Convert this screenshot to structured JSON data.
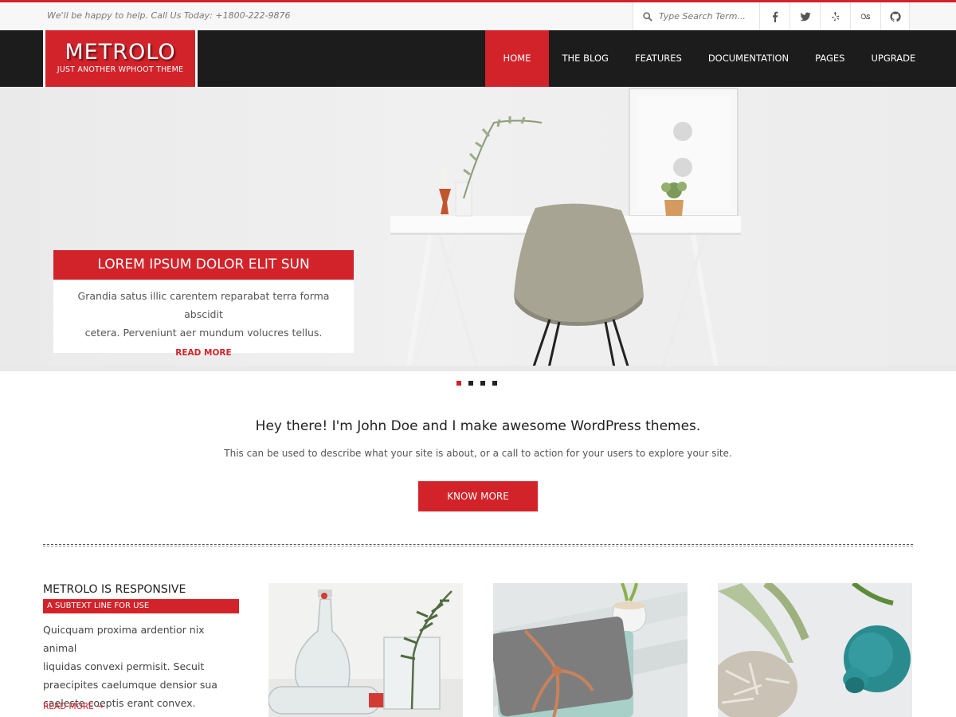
{
  "topbar": {
    "tagline": "We'll be happy to help. Call Us Today: +1800-222-9876",
    "search_placeholder": "Type Search Term...",
    "social": [
      "facebook-icon",
      "twitter-icon",
      "yelp-icon",
      "lastfm-icon",
      "github-icon"
    ]
  },
  "logo": {
    "name": "METROLO",
    "tagline": "JUST ANOTHER WPHOOT THEME"
  },
  "nav": {
    "items": [
      "HOME",
      "THE BLOG",
      "FEATURES",
      "DOCUMENTATION",
      "PAGES",
      "UPGRADE"
    ],
    "active": "HOME"
  },
  "slider": {
    "heading": "LOREM IPSUM DOLOR ELIT SUN",
    "text_line1": "Grandia satus illic carentem reparabat terra forma abscidit",
    "text_line2": "cetera. Perveniunt aer mundum volucres tellus.",
    "read_more": "READ MORE",
    "slide_count": 4,
    "active_slide": 1
  },
  "cta": {
    "title": "Hey there! I'm John Doe and I make awesome WordPress themes.",
    "text": "This can be used to describe what your site is about, or a call to action for your users to explore your site.",
    "button": "KNOW MORE"
  },
  "feature": {
    "title": "METROLO IS RESPONSIVE",
    "subtext": "A SUBTEXT LINE FOR USE",
    "body_lines": [
      "Quicquam proxima ardentior nix animal",
      "liquidas convexi permisit. Secuit",
      "praecipites caelumque densior sua",
      "caeleste coeptis erant convex."
    ],
    "read_more": "READ MORE →"
  },
  "colors": {
    "accent": "#d2232a",
    "header_bg": "#1c1c1c"
  }
}
